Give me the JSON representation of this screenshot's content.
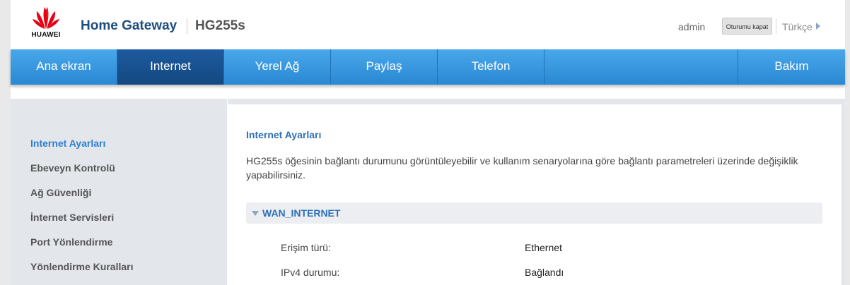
{
  "header": {
    "brand": "HUAWEI",
    "title": "Home Gateway",
    "model": "HG255s",
    "user": "admin",
    "logout_label": "Oturumu kapat",
    "language": "Türkçe",
    "brand_color": "#e60012"
  },
  "nav": {
    "items": [
      {
        "label": "Ana ekran"
      },
      {
        "label": "Internet"
      },
      {
        "label": "Yerel Ağ"
      },
      {
        "label": "Paylaş"
      },
      {
        "label": "Telefon"
      },
      {
        "label": "Bakım"
      }
    ],
    "active": "Internet",
    "accent": "#2a88d4"
  },
  "sidebar": {
    "items": [
      {
        "label": "Internet Ayarları"
      },
      {
        "label": "Ebeveyn Kontrolü"
      },
      {
        "label": "Ağ Güvenliği"
      },
      {
        "label": "İnternet Servisleri"
      },
      {
        "label": "Port Yönlendirme"
      },
      {
        "label": "Yönlendirme Kuralları"
      }
    ],
    "active": "Internet Ayarları"
  },
  "content": {
    "title": "Internet Ayarları",
    "description": "HG255s öğesinin bağlantı durumunu görüntüleyebilir ve kullanım senaryolarına göre bağlantı parametreleri üzerinde değişiklik yapabilirsiniz.",
    "wan_section": "WAN_INTERNET",
    "rows": [
      {
        "label": "Erişim türü:",
        "value": "Ethernet"
      },
      {
        "label": "IPv4 durumu:",
        "value": "Bağlandı"
      }
    ]
  }
}
